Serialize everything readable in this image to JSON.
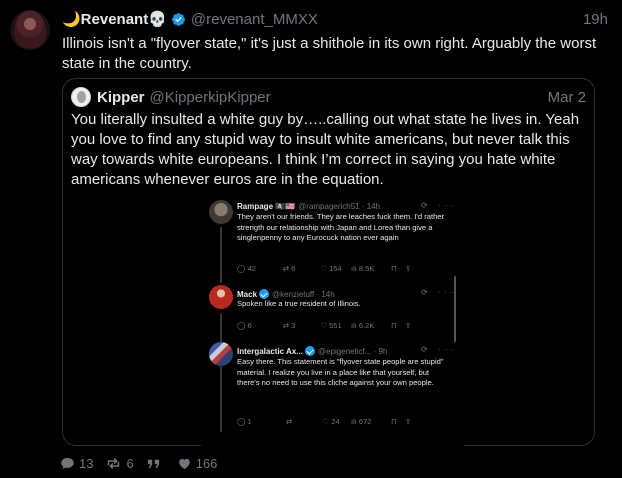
{
  "tweet": {
    "display_name": "🌙Revenant💀",
    "handle": "@revenant_MMXX",
    "time": "19h",
    "text": "Illinois isn't a \"flyover state,\" it's just a shithole in its own right. Arguably the worst state in the country."
  },
  "quoted": {
    "display_name": "Kipper",
    "handle": "@KipperkipKipper",
    "time": "Mar 2",
    "text": "You literally insulted a white guy by…..calling out what state he lives in. Yeah you love to find any stupid way to insult white americans, but never talk this way towards white europeans. I think I’m correct in saying you hate white americans whenever euros are in the equation."
  },
  "screenshot_replies": [
    {
      "name": "Rampage 🏴‍☠️🇺🇸",
      "handle": "@rampagerich51 · 14h",
      "text": "They aren't our friends. They are leaches fuck them. I'd rather strength our relationship with Japan and Lorea than give a singlenpenny to any Eurocuck nation ever again",
      "replies": "42",
      "reposts": "6",
      "likes": "154",
      "views": "8.5K"
    },
    {
      "name": "Mack",
      "handle": "@kenzietuff · 14h",
      "text": "Spoken like a true resident of Illinois.",
      "replies": "6",
      "reposts": "3",
      "likes": "551",
      "views": "6.2K"
    },
    {
      "name": "Intergalactic Ax...",
      "handle": "@epigeneticf... · 9h",
      "text": "Easy there. This statement is \"flyover state people are stupid\" material. I realize you live in a place like that yourself, but there's no need to use this cliche against your own people.",
      "replies": "1",
      "reposts": "",
      "likes": "24",
      "views": "672"
    }
  ],
  "footer": {
    "replies": "13",
    "reposts": "6",
    "likes": "166"
  },
  "colors": {
    "background": "#000000",
    "text": "#e7e9ea",
    "muted": "#71767b",
    "border": "#2f3336",
    "verified": "#1d9bf0"
  },
  "icons": [
    "verified-badge-icon",
    "reply-icon",
    "repost-icon",
    "quote-icon",
    "like-icon",
    "views-icon",
    "bookmark-icon",
    "share-icon",
    "grok-icon",
    "more-icon"
  ]
}
